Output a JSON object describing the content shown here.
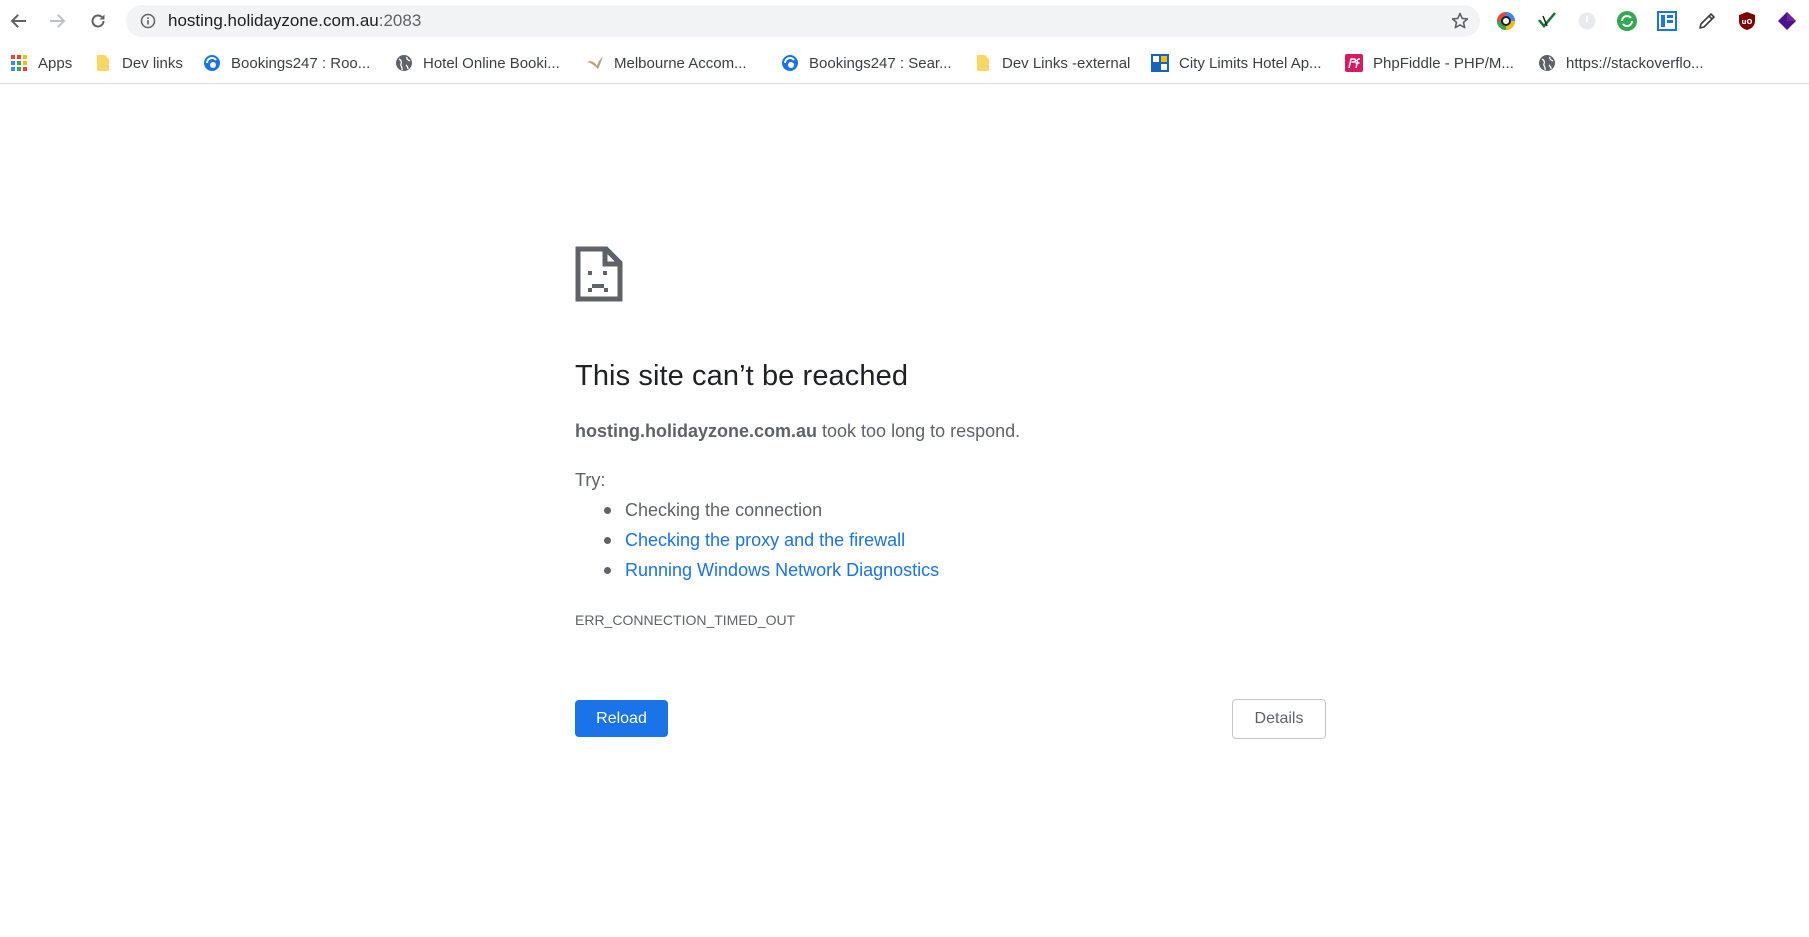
{
  "browser": {
    "url_host": "hosting.holidayzone.com.au",
    "url_port": ":2083",
    "icons": {
      "back": "back-arrow-icon",
      "forward": "forward-arrow-icon",
      "reload": "reload-icon",
      "info": "info-icon",
      "bookmark_star": "star-icon"
    },
    "extensions": [
      "color-picker-extension-icon",
      "checkmark-extension-icon",
      "grey-circle-extension-icon",
      "green-sync-extension-icon",
      "blue-grid-extension-icon",
      "pencil-extension-icon",
      "ublock-shield-icon",
      "purple-diamond-extension-icon"
    ]
  },
  "bookmarks": [
    {
      "label": "Apps",
      "icon": "apps-grid-icon"
    },
    {
      "label": "Dev links",
      "icon": "folder-icon"
    },
    {
      "label": "Bookings247 : Roo...",
      "icon": "bookings-globe-icon"
    },
    {
      "label": "Hotel Online Booki...",
      "icon": "globe-icon"
    },
    {
      "label": "Melbourne Accom...",
      "icon": "bird-icon"
    },
    {
      "label": "Bookings247 : Sear...",
      "icon": "bookings-globe-icon"
    },
    {
      "label": "Dev Links -external",
      "icon": "folder-icon"
    },
    {
      "label": "City Limits Hotel Ap...",
      "icon": "save-logo-icon"
    },
    {
      "label": "PhpFiddle - PHP/M...",
      "icon": "phpfiddle-logo-icon"
    },
    {
      "label": "https://stackoverflo...",
      "icon": "globe-icon"
    }
  ],
  "error": {
    "icon": "sad-document-icon",
    "title": "This site can’t be reached",
    "host": "hosting.holidayzone.com.au",
    "message": " took too long to respond.",
    "try_label": "Try:",
    "suggestions": [
      "Checking the connection",
      "Checking the proxy and the firewall",
      "Running Windows Network Diagnostics"
    ],
    "code": "ERR_CONNECTION_TIMED_OUT",
    "reload_label": "Reload",
    "details_label": "Details"
  },
  "colors": {
    "primary_blue": "#1a73e8",
    "text_secondary": "#5f6368",
    "omnibox_bg": "#f1f3f4"
  }
}
